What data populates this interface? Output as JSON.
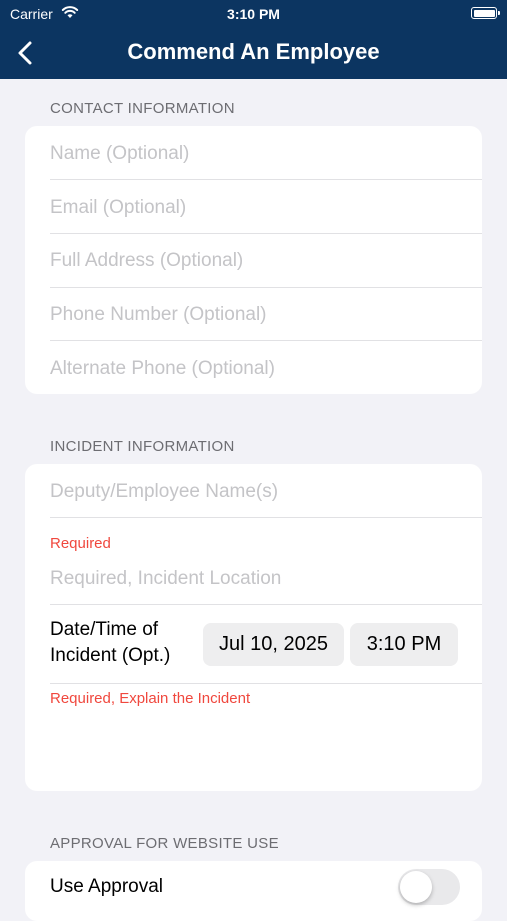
{
  "status_bar": {
    "carrier": "Carrier",
    "time": "3:10 PM"
  },
  "nav": {
    "title": "Commend An Employee"
  },
  "contact": {
    "header": "CONTACT INFORMATION",
    "fields": [
      "Name (Optional)",
      "Email (Optional)",
      "Full Address (Optional)",
      "Phone Number (Optional)",
      "Alternate Phone (Optional)"
    ]
  },
  "incident": {
    "header": "INCIDENT INFORMATION",
    "employee_names_placeholder": "Deputy/Employee Name(s)",
    "location_required_label": "Required",
    "location_placeholder": "Required, Incident Location",
    "datetime_label_line1": "Date/Time of",
    "datetime_label_line2": "Incident (Opt.)",
    "date_value": "Jul 10, 2025",
    "time_value": "3:10 PM",
    "explain_placeholder": "Required, Explain the Incident"
  },
  "approval": {
    "header": "APPROVAL FOR WEBSITE USE",
    "use_approval_label": "Use Approval",
    "use_approval_on": false
  },
  "colors": {
    "nav_background": "#0c3561",
    "required_red": "#f0483e"
  }
}
